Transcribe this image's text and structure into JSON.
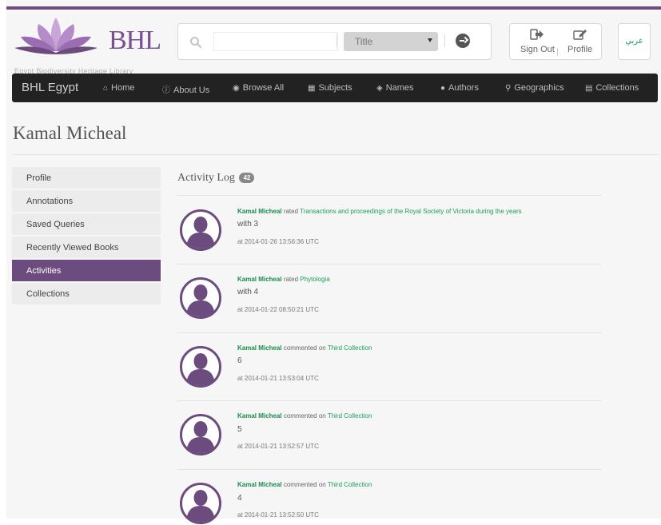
{
  "site": {
    "logo_text": "BHL",
    "logo_subtitle": "Egypt Biodiversity Heritage Library"
  },
  "search": {
    "placeholder": "",
    "field_selected": "Title"
  },
  "user_menu": {
    "sign_out": "Sign Out",
    "profile": "Profile"
  },
  "language": "عربي",
  "navbar": {
    "brand": "BHL Egypt",
    "items": [
      {
        "label": "Home",
        "icon": "home-icon"
      },
      {
        "label": "About Us",
        "icon": "info-icon"
      },
      {
        "label": "Browse All",
        "icon": "globe-icon"
      },
      {
        "label": "Subjects",
        "icon": "sitemap-icon"
      },
      {
        "label": "Names",
        "icon": "tags-icon"
      },
      {
        "label": "Authors",
        "icon": "user-icon"
      },
      {
        "label": "Geographics",
        "icon": "map-marker-icon"
      },
      {
        "label": "Collections",
        "icon": "bars-icon"
      }
    ]
  },
  "page": {
    "title": "Kamal Micheal"
  },
  "sidebar": {
    "items": [
      {
        "label": "Profile",
        "active": false
      },
      {
        "label": "Annotations",
        "active": false
      },
      {
        "label": "Saved Queries",
        "active": false
      },
      {
        "label": "Recently Viewed Books",
        "active": false
      },
      {
        "label": "Activities",
        "active": true
      },
      {
        "label": "Collections",
        "active": false
      }
    ]
  },
  "activity_log": {
    "title": "Activity Log",
    "count": "42",
    "entries": [
      {
        "user": "Kamal Micheal",
        "action": "rated",
        "target": "Transactions and proceedings of the Royal Society of Victoria during the years",
        "value": "with 3",
        "time": "at 2014-01-26 13:56:36 UTC"
      },
      {
        "user": "Kamal Micheal",
        "action": "rated",
        "target": "Phytologia",
        "value": "with 4",
        "time": "at 2014-01-22 08:50:21 UTC"
      },
      {
        "user": "Kamal Micheal",
        "action": "commented on",
        "target": "Third Collection",
        "value": "6",
        "time": "at 2014-01-21 13:53:04 UTC"
      },
      {
        "user": "Kamal Micheal",
        "action": "commented on",
        "target": "Third Collection",
        "value": "5",
        "time": "at 2014-01-21 13:52:57 UTC"
      },
      {
        "user": "Kamal Micheal",
        "action": "commented on",
        "target": "Third Collection",
        "value": "4",
        "time": "at 2014-01-21 13:52:50 UTC"
      }
    ]
  },
  "colors": {
    "brand_purple": "#6c4c7e",
    "link_green": "#1aa05a",
    "navbar_bg": "#222222"
  }
}
